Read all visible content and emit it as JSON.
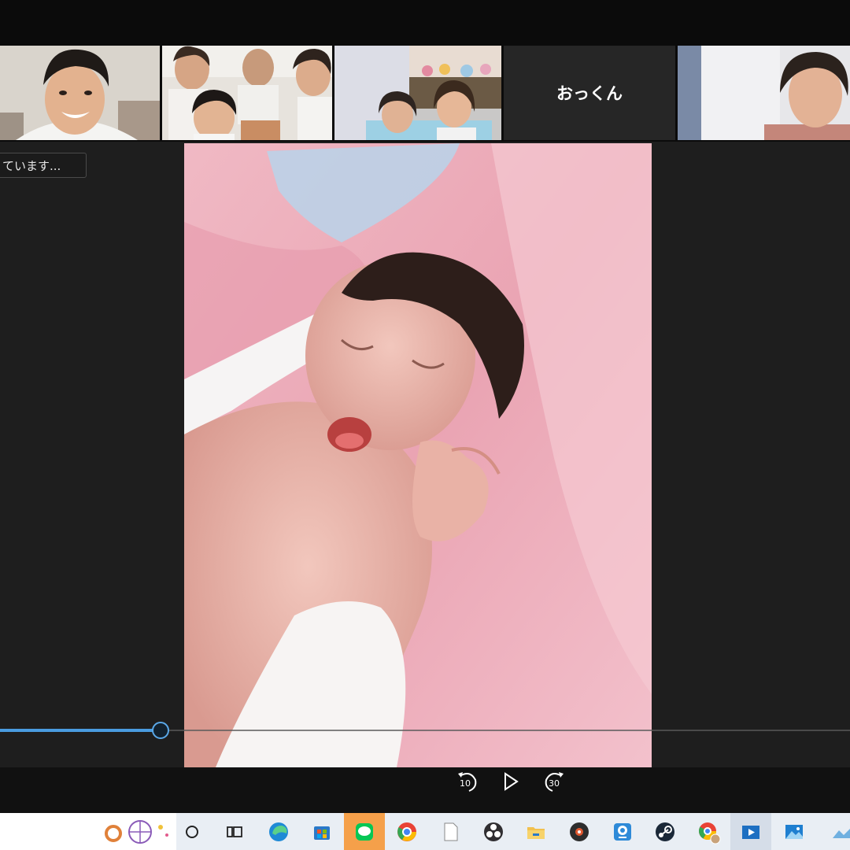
{
  "participants": {
    "tile4_name": "おっくん"
  },
  "status_text": "ています...",
  "seek": {
    "progress": 0.189
  },
  "controls": {
    "rewind_label": "10",
    "forward_label": "30"
  },
  "taskbar": {
    "icons": [
      "search-art",
      "cortana-circle",
      "task-view",
      "edge",
      "store",
      "line",
      "chrome",
      "file",
      "obs",
      "file-explorer",
      "media-disc",
      "webcam",
      "steam",
      "chrome-profile",
      "video-player",
      "photos"
    ]
  },
  "colors": {
    "seek_blue": "#4a9ce0",
    "taskbar_bg": "#e9eef4",
    "line_green": "#06c755",
    "active_orange": "#f5a04a"
  }
}
